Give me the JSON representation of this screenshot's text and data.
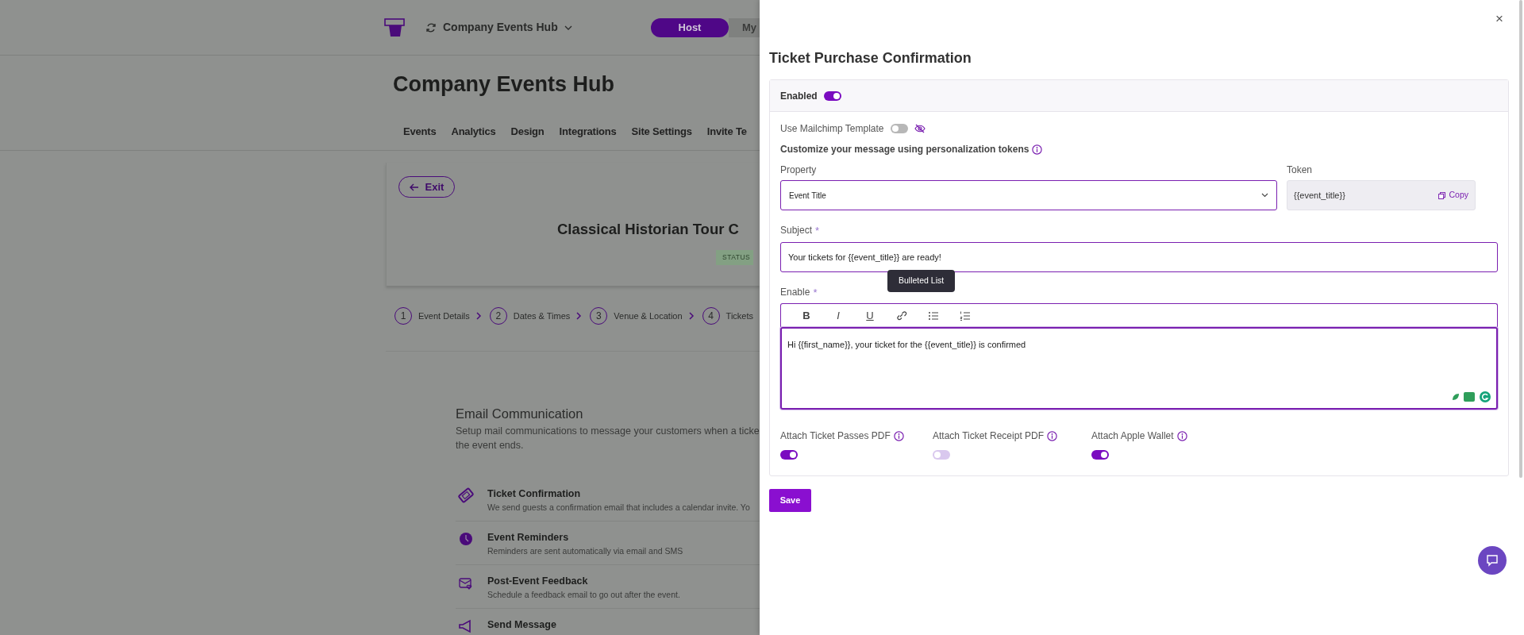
{
  "background_page": {
    "workspace": "Company Events Hub",
    "mode_toggle": [
      {
        "label": "Host",
        "selected": true
      },
      {
        "label": "My",
        "selected": false
      }
    ],
    "title": "Company Events Hub",
    "nav": [
      "Events",
      "Analytics",
      "Design",
      "Integrations",
      "Site Settings",
      "Invite Te"
    ],
    "exit_button": "Exit",
    "event_title": "Classical Historian Tour C",
    "status_badge": "STATUS",
    "steps": [
      {
        "number": "1",
        "label": "Event Details"
      },
      {
        "number": "2",
        "label": "Dates & Times"
      },
      {
        "number": "3",
        "label": "Venue & Location"
      },
      {
        "number": "4",
        "label": "Tickets"
      }
    ],
    "email_section": {
      "title": "Email Communication",
      "description_lines": [
        "Setup mail communications to message your customers when a ticke",
        "the event ends."
      ],
      "items": [
        {
          "kind": "ticket",
          "title": "Ticket Confirmation",
          "description": "We send guests a confirmation email that includes a calendar invite. Yo"
        },
        {
          "kind": "clock",
          "title": "Event Reminders",
          "description": "Reminders are sent automatically via email and SMS"
        },
        {
          "kind": "mail",
          "title": "Post-Event Feedback",
          "description": "Schedule a feedback email to go out after the event."
        },
        {
          "kind": "megaphone",
          "title": "Send Message"
        }
      ]
    }
  },
  "drawer": {
    "close_button": "×",
    "title": "Ticket Purchase Confirmation",
    "enabled": {
      "label": "Enabled",
      "on": true
    },
    "mailchimp": {
      "label": "Use Mailchimp Template",
      "on": false
    },
    "tokens_hint": "Customize your message using personalization tokens",
    "property": {
      "label": "Property",
      "value": "Event Title"
    },
    "token": {
      "label": "Token",
      "value": "{{event_title}}",
      "copy": "Copy"
    },
    "subject": {
      "label": "Subject",
      "required_mark": "*",
      "value": "Your tickets for {{event_title}} are ready!"
    },
    "body": {
      "label": "Enable",
      "required_mark": "*",
      "tooltip": "Bulleted List",
      "toolbar": [
        {
          "kind": "bold",
          "label": "B"
        },
        {
          "kind": "italic",
          "label": "I"
        },
        {
          "kind": "underline",
          "label": "U"
        },
        {
          "kind": "link"
        },
        {
          "kind": "bullets"
        },
        {
          "kind": "numbers"
        }
      ],
      "text": "Hi {{first_name}}, your ticket for the {{event_title}} is confirmed"
    },
    "attachments": [
      {
        "label": "Attach Ticket Passes PDF",
        "on": true
      },
      {
        "label": "Attach Ticket Receipt PDF",
        "on": false
      },
      {
        "label": "Attach Apple Wallet",
        "on": true
      }
    ],
    "save_button": "Save"
  }
}
